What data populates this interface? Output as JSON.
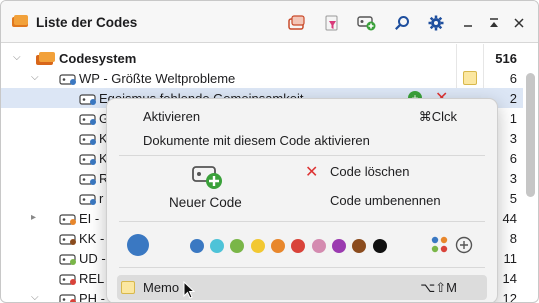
{
  "header": {
    "title": "Liste der Codes"
  },
  "tree": {
    "root": {
      "label": "Codesystem",
      "count": "516"
    },
    "rows": [
      {
        "label": "WP - Größte Weltprobleme",
        "count": "6"
      },
      {
        "label": "Egoismus fehlende Gemeinsamkeit",
        "count": "2"
      },
      {
        "label": "G",
        "count": "1"
      },
      {
        "label": "K",
        "count": "3"
      },
      {
        "label": "K",
        "count": "6"
      },
      {
        "label": "R",
        "count": "3"
      },
      {
        "label": "r",
        "count": "5"
      },
      {
        "label": "EI - ",
        "count": "44"
      },
      {
        "label": "KK - ",
        "count": "8"
      },
      {
        "label": "UD - ",
        "count": "11"
      },
      {
        "label": "REL",
        "count": "14"
      },
      {
        "label": "PH - ",
        "count": "12"
      }
    ]
  },
  "menu": {
    "activate": "Aktivieren",
    "activate_shortcut": "⌘Clck",
    "activate_docs": "Dokumente mit diesem Code aktivieren",
    "new_code": "Neuer Code",
    "delete_code": "Code löschen",
    "rename_code": "Code umbenennen",
    "memo": "Memo",
    "memo_shortcut": "⌥⇧M",
    "current_color": "#3a78c2",
    "colors": [
      "#3a78c2",
      "#4ec3d8",
      "#7ab648",
      "#f2c832",
      "#e8872c",
      "#d9433a",
      "#d48bb0",
      "#9b3bb0",
      "#8b4c1e",
      "#111111"
    ]
  },
  "icons": {
    "header": "codes-icon",
    "toolbar": [
      "new-code-set-icon",
      "filter-icon",
      "add-code-icon",
      "search-icon",
      "gear-icon",
      "minimize-icon",
      "maximize-icon",
      "close-icon"
    ]
  }
}
